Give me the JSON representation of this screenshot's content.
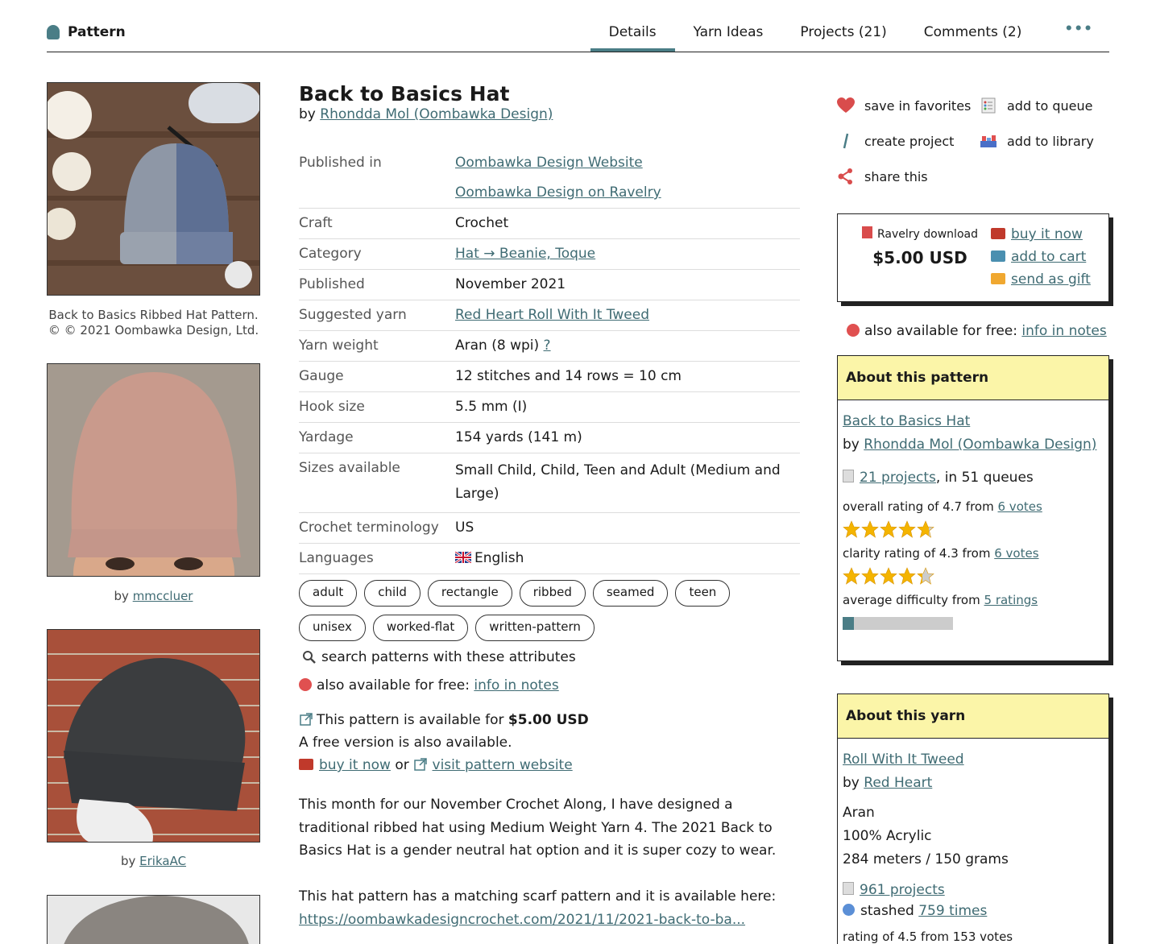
{
  "header": {
    "brand": "Pattern",
    "tabs": [
      {
        "label": "Details",
        "active": true
      },
      {
        "label": "Yarn Ideas"
      },
      {
        "label": "Projects (21)"
      },
      {
        "label": "Comments (2)"
      },
      {
        "label": "•••"
      }
    ]
  },
  "photos": [
    {
      "caption_line1": "Back to Basics Ribbed Hat Pattern.",
      "caption_line2": "© © 2021 Oombawka Design, Ltd."
    },
    {
      "by": "by",
      "user": "mmccluer"
    },
    {
      "by": "by",
      "user": "ErikaAC"
    }
  ],
  "pattern": {
    "title": "Back to Basics Hat",
    "by": "by",
    "designer": "Rhondda Mol (Oombawka Design)",
    "details": [
      {
        "key": "Published in",
        "value": "Oombawka Design Website",
        "value2": "Oombawka Design on Ravelry",
        "link": true
      },
      {
        "key": "Craft",
        "value": "Crochet"
      },
      {
        "key": "Category",
        "value": "Hat → Beanie, Toque",
        "link": true
      },
      {
        "key": "Published",
        "value": "November 2021"
      },
      {
        "key": "Suggested yarn",
        "value": "Red Heart Roll With It Tweed",
        "link": true
      },
      {
        "key": "Yarn weight",
        "value": "Aran (8 wpi)",
        "extra": "?"
      },
      {
        "key": "Gauge",
        "value": "12 stitches and 14 rows = 10 cm"
      },
      {
        "key": "Hook size",
        "value": "5.5 mm (I)"
      },
      {
        "key": "Yardage",
        "value": "154 yards (141 m)"
      },
      {
        "key": "Sizes available",
        "value": "Small Child, Child, Teen and Adult (Medium and Large)"
      },
      {
        "key": "Crochet terminology",
        "value": "US"
      },
      {
        "key": "Languages",
        "value": "English",
        "flag": true
      }
    ],
    "tags": [
      "adult",
      "child",
      "rectangle",
      "ribbed",
      "seamed",
      "teen",
      "unisex",
      "worked-flat",
      "written-pattern"
    ],
    "search_attrs": "search patterns with these attributes",
    "also_free": "also available for free:",
    "info_notes": "info in notes",
    "avail_pre": "This pattern is available for",
    "avail_price": "$5.00 USD",
    "free_version": "A free version is also available.",
    "buy_now": "buy it now",
    "or": "or",
    "visit": "visit pattern website",
    "para1": "This month for our November Crochet Along, I have designed a traditional ribbed hat using Medium Weight Yarn 4. The 2021 Back to Basics Hat is a gender neutral hat option and it is super cozy to wear.",
    "para2": "This hat pattern has a matching scarf pattern and it is available here:",
    "para2_link": "https://oombawkadesigncrochet.com/2021/11/2021-back-to-ba..."
  },
  "actions": {
    "fav": "save in favorites",
    "queue": "add to queue",
    "project": "create project",
    "library": "add to library",
    "share": "share this"
  },
  "buybox": {
    "label": "Ravelry download",
    "price": "$5.00 USD",
    "buy": "buy it now",
    "cart": "add to cart",
    "gift": "send as gift"
  },
  "about_pattern": {
    "heading": "About this pattern",
    "name": "Back to Basics Hat",
    "by": "by",
    "designer": "Rhondda Mol (Oombawka Design)",
    "projects": "21 projects",
    "queues": ", in 51 queues",
    "overall_pre": "overall rating of 4.7 from",
    "overall_votes": "6 votes",
    "overall": 4.7,
    "clarity_pre": "clarity rating of 4.3 from",
    "clarity_votes": "6 votes",
    "clarity": 4.3,
    "difficulty_pre": "average difficulty from",
    "difficulty_votes": "5 ratings",
    "difficulty_fraction": 0.1
  },
  "about_yarn": {
    "heading": "About this yarn",
    "name": "Roll With It Tweed",
    "by": "by",
    "brand": "Red Heart",
    "weight": "Aran",
    "fiber": "100% Acrylic",
    "length": "284 meters / 150 grams",
    "projects": "961 projects",
    "stashed_pre": "stashed",
    "stashed": "759 times",
    "rating": "rating of 4.5 from 153 votes"
  },
  "colors": {
    "accent": "#4a7d86",
    "link": "#3f6b73",
    "panel": "#fbf5a8"
  }
}
